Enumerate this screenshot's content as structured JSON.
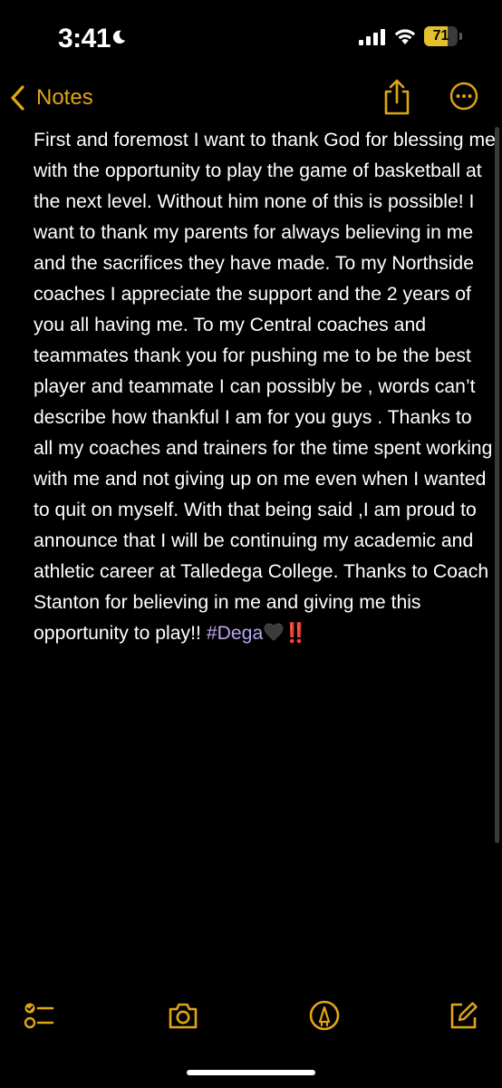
{
  "status_bar": {
    "time": "3:41",
    "battery_percent": "71",
    "battery_level": 0.71,
    "icons": [
      "moon-icon",
      "cellular-signal-icon",
      "wifi-icon",
      "battery-icon"
    ]
  },
  "nav": {
    "back_label": "Notes",
    "icons": [
      "chevron-left-icon",
      "share-icon",
      "more-icon"
    ]
  },
  "note": {
    "text": "First and foremost I want to thank God for blessing me with the opportunity to play the game of basketball at the next level. Without him none of this is possible! I want to thank my parents for always believing in me and the sacrifices they have made. To my Northside coaches I appreciate the support and the 2 years of you all having me. To my Central coaches and teammates thank you for pushing me to be the best player and teammate I can possibly be , words can’t describe how thankful I am for you guys . Thanks to all my coaches and trainers for the time spent working with me and not giving up on me even when I wanted to quit on myself. With that being said ,I am proud to announce that I will be continuing my academic and athletic career at Talledega College. Thanks to Coach Stanton for believing in me and giving me this opportunity to play!! ",
    "hashtag": "#Dega",
    "emoji_bangs": "‼️"
  },
  "toolbar": {
    "icons": [
      "checklist-icon",
      "camera-icon",
      "markup-icon",
      "compose-icon"
    ]
  },
  "colors": {
    "accent": "#e0a614",
    "background": "#000000",
    "text": "#ffffff",
    "hashtag": "#b9a6ee",
    "battery_fill": "#e4c12a",
    "red_emoji": "#e01818"
  }
}
